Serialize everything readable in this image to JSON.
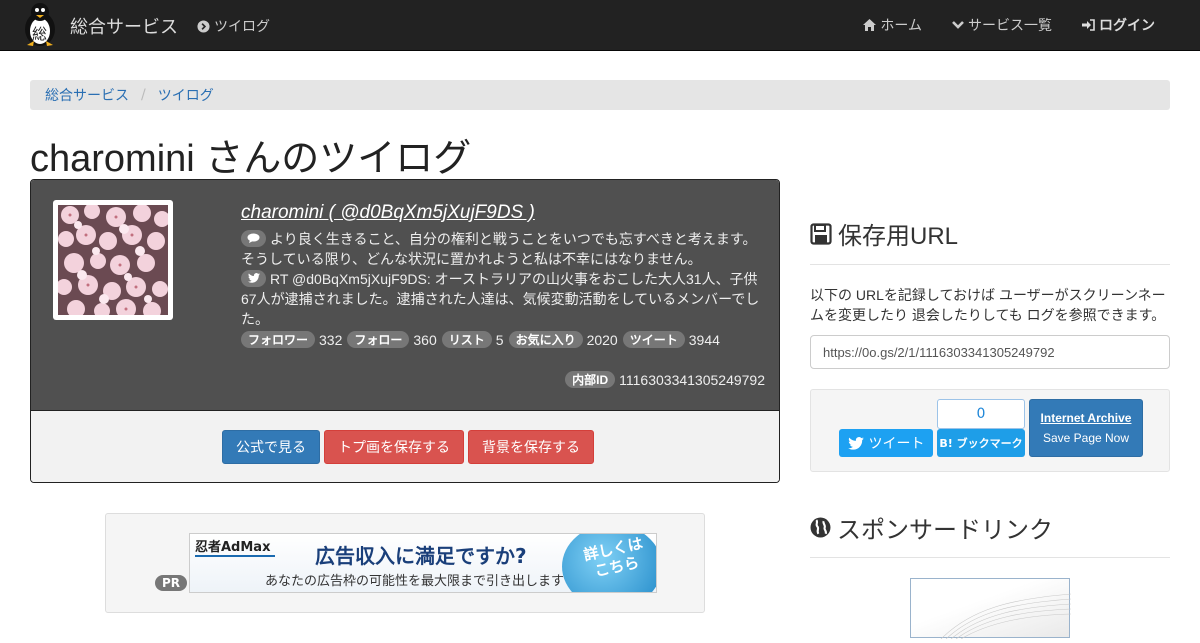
{
  "navbar": {
    "brand": "総合サービス",
    "logo_char": "総",
    "tweetlog_link": "ツイログ",
    "home": "ホーム",
    "services": "サービス一覧",
    "login": "ログイン"
  },
  "breadcrumb": [
    "総合サービス",
    "ツイログ"
  ],
  "page_title": "charomini さんのツイログ",
  "profile": {
    "name": "charomini ( @d0BqXm5jXujF9DS )",
    "bio": "より良く生きること、自分の権利と戦うことをいつでも忘すべきと考えます。そうしている限り、どんな状況に置かれようと私は不幸にはなりません。",
    "latest_tweet": "RT @d0BqXm5jXujF9DS: オーストラリアの山火事をおこした大人31人、子供67人が逮捕されました。逮捕された人達は、気候変動活動をしているメンバーでした。",
    "stats": [
      {
        "label": "フォロワー",
        "value": "332"
      },
      {
        "label": "フォロー",
        "value": "360"
      },
      {
        "label": "リスト",
        "value": "5"
      },
      {
        "label": "お気に入り",
        "value": "2020"
      },
      {
        "label": "ツイート",
        "value": "3944"
      }
    ],
    "internal_id_label": "内部ID",
    "internal_id": "1116303341305249792",
    "buttons": {
      "official": "公式で見る",
      "save_icon": "トプ画を保存する",
      "save_bg": "背景を保存する"
    }
  },
  "ad": {
    "pr": "PR",
    "logo": "忍者AdMax",
    "headline": "広告収入に満足ですか?",
    "sub": "あなたの広告枠の可能性を最大限まで引き出します",
    "cta": "詳しくはこちら"
  },
  "save_section": {
    "title": "保存用URL",
    "description": "以下の URLを記録しておけば ユーザーがスクリーンネームを変更したり 退会したりしても ログを参照できます。",
    "url": "https://0o.gs/2/1/1116303341305249792",
    "tweet_button": "ツイート",
    "hatena_count": "0",
    "hatena_button": "B! ブックマーク",
    "archive_title": "Internet Archive",
    "archive_action": "Save Page Now"
  },
  "sponsor_section": {
    "title": "スポンサードリンク"
  },
  "colors": {
    "navbar": "#222222",
    "primary": "#337ab7",
    "danger": "#d9534f",
    "twitter": "#1da1f2",
    "hatena": "#1e9ee8"
  }
}
